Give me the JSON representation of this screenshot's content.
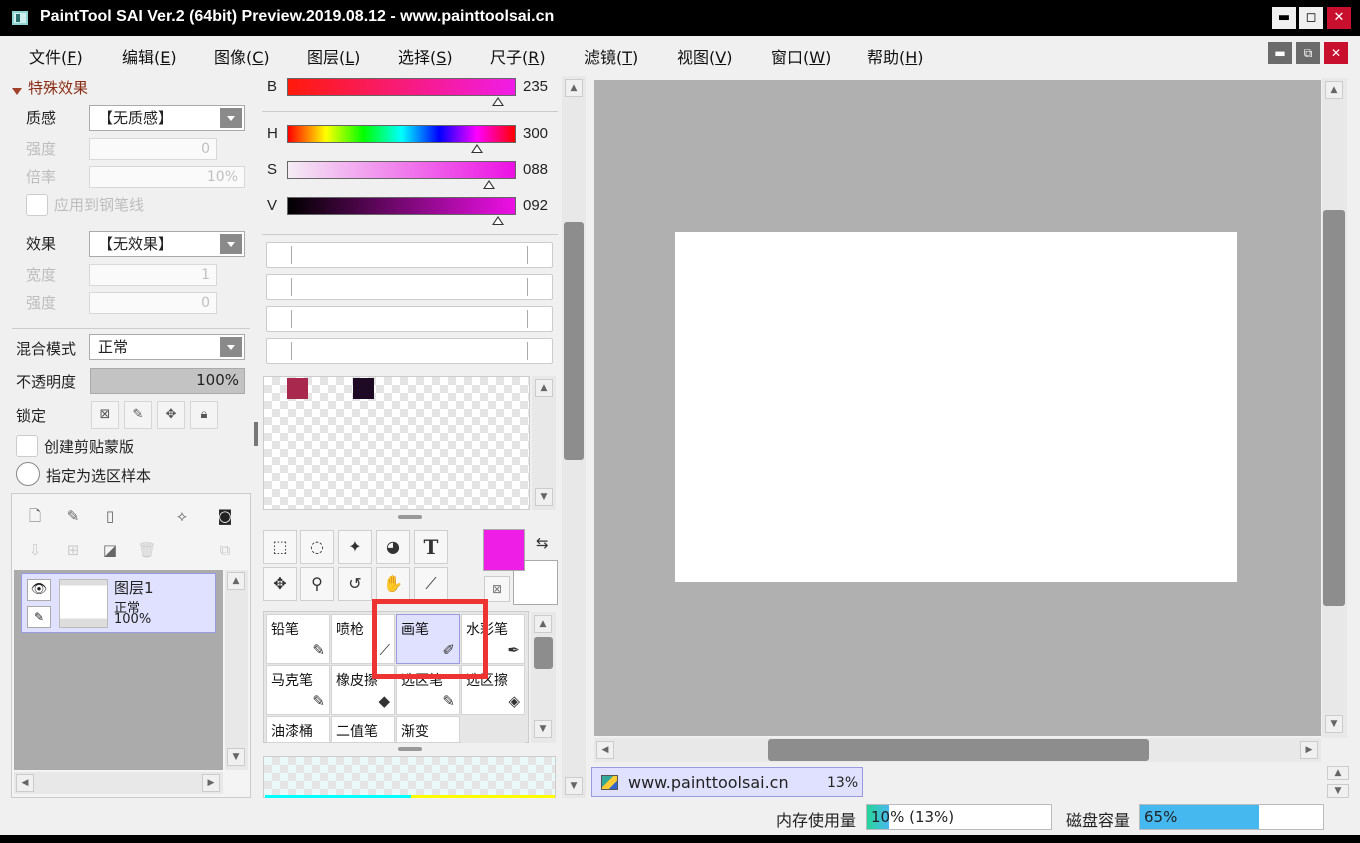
{
  "window": {
    "title": "PaintTool SAI Ver.2 (64bit) Preview.2019.08.12 - www.painttoolsai.cn",
    "minimize": "▬",
    "maximize": "◻",
    "close": "✕"
  },
  "menu": [
    {
      "label": "文件(",
      "key": "F",
      "end": ")"
    },
    {
      "label": "编辑(",
      "key": "E",
      "end": ")"
    },
    {
      "label": "图像(",
      "key": "C",
      "end": ")"
    },
    {
      "label": "图层(",
      "key": "L",
      "end": ")"
    },
    {
      "label": "选择(",
      "key": "S",
      "end": ")"
    },
    {
      "label": "尺子(",
      "key": "R",
      "end": ")"
    },
    {
      "label": "滤镜(",
      "key": "T",
      "end": ")"
    },
    {
      "label": "视图(",
      "key": "V",
      "end": ")"
    },
    {
      "label": "窗口(",
      "key": "W",
      "end": ")"
    },
    {
      "label": "帮助(",
      "key": "H",
      "end": ")"
    }
  ],
  "effects": {
    "section_title": "特殊效果",
    "texture_label": "质感",
    "texture_value": "【无质感】",
    "strength_label": "强度",
    "strength_value": "0",
    "scale_label": "倍率",
    "scale_value": "10%",
    "apply_pen_label": "应用到钢笔线",
    "effect_label": "效果",
    "effect_value": "【无效果】",
    "width_label": "宽度",
    "width_value": "1",
    "strength2_label": "强度",
    "strength2_value": "0"
  },
  "layer_props": {
    "blend_label": "混合模式",
    "blend_value": "正常",
    "opacity_label": "不透明度",
    "opacity_value": "100%",
    "opacity_fraction": 1.0,
    "lock_label": "锁定",
    "clipping_label": "创建剪贴蒙版",
    "selection_source_label": "指定为选区样本"
  },
  "layers": [
    {
      "name": "图层1",
      "mode": "正常",
      "opacity": "100%"
    }
  ],
  "color_sliders": {
    "rgb_b": {
      "label": "B",
      "value": "235",
      "fraction": 0.92
    },
    "h": {
      "label": "H",
      "value": "300",
      "fraction": 0.83
    },
    "s": {
      "label": "S",
      "value": "088",
      "fraction": 0.88
    },
    "v": {
      "label": "V",
      "value": "092",
      "fraction": 0.92
    }
  },
  "swatches": {
    "colors": [
      "#a8284e",
      "#1e0a24"
    ]
  },
  "colors": {
    "foreground": "#ee1ee6",
    "background": "#ffffff",
    "accent_selected": "#e0e0ff",
    "highlight_box": "#ee3333"
  },
  "tools": [
    {
      "name": "rect-select",
      "glyph": "⬚"
    },
    {
      "name": "lasso",
      "glyph": "◌"
    },
    {
      "name": "magic-wand",
      "glyph": "✦"
    },
    {
      "name": "shape-fill",
      "glyph": "◕"
    },
    {
      "name": "text",
      "glyph": "T"
    },
    {
      "name": "move",
      "glyph": "✥"
    },
    {
      "name": "zoom",
      "glyph": "⚲"
    },
    {
      "name": "rotate",
      "glyph": "↺"
    },
    {
      "name": "hand",
      "glyph": "✋"
    },
    {
      "name": "eyedropper",
      "glyph": "⟋"
    }
  ],
  "brushes": [
    {
      "label": "铅笔",
      "icon": "✎",
      "selected": false
    },
    {
      "label": "喷枪",
      "icon": "⟋",
      "selected": false
    },
    {
      "label": "画笔",
      "icon": "✐",
      "selected": true
    },
    {
      "label": "水彩笔",
      "icon": "✒",
      "selected": false
    },
    {
      "label": "马克笔",
      "icon": "✎",
      "selected": false
    },
    {
      "label": "橡皮擦",
      "icon": "◆",
      "selected": false
    },
    {
      "label": "选区笔",
      "icon": "✎",
      "selected": false
    },
    {
      "label": "选区擦",
      "icon": "◈",
      "selected": false
    },
    {
      "label": "油漆桶",
      "icon": "",
      "selected": false
    },
    {
      "label": "二值笔",
      "icon": "",
      "selected": false
    },
    {
      "label": "渐变",
      "icon": "",
      "selected": false
    }
  ],
  "document_tab": {
    "name": "www.painttoolsai.cn",
    "zoom": "13%"
  },
  "status": {
    "memory_label": "内存使用量",
    "memory_value": "10% (13%)",
    "memory_fraction": 0.1,
    "disk_label": "磁盘容量",
    "disk_value": "65%",
    "disk_fraction": 0.65
  }
}
